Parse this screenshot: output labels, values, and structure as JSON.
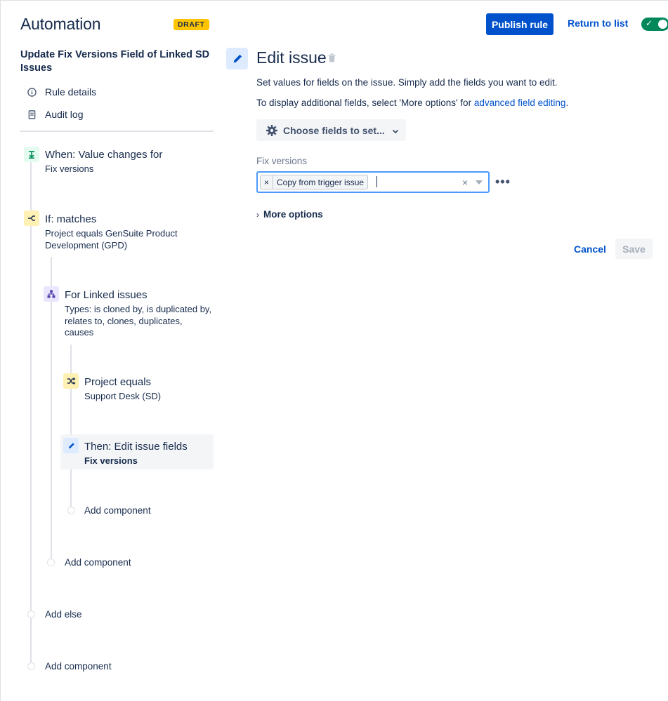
{
  "header": {
    "title": "Automation",
    "badge": "DRAFT",
    "publish_label": "Publish rule",
    "return_label": "Return to list",
    "toggle_on": true
  },
  "sidebar": {
    "rule_name": "Update Fix Versions Field of Linked SD Issues",
    "links": [
      {
        "label": "Rule details",
        "icon": "info-icon"
      },
      {
        "label": "Audit log",
        "icon": "document-icon"
      }
    ],
    "steps": {
      "trigger": {
        "title": "When: Value changes for",
        "subtitle": "Fix versions",
        "icon": "trigger-icon"
      },
      "condition": {
        "title": "If: matches",
        "subtitle": "Project equals GenSuite Product Development (GPD)",
        "icon": "if-branch-icon"
      },
      "branch": {
        "title": "For Linked issues",
        "subtitle": "Types: is cloned by, is duplicated by, relates to, clones, duplicates, causes",
        "icon": "hierarchy-icon"
      },
      "nested_condition": {
        "title": "Project equals",
        "subtitle": "Support Desk (SD)",
        "icon": "shuffle-icon"
      },
      "action": {
        "title": "Then: Edit issue fields",
        "subtitle": "Fix versions",
        "icon": "pencil-icon"
      }
    },
    "add_component_label": "Add component",
    "add_else_label": "Add else"
  },
  "main": {
    "title": "Edit issue",
    "desc1": "Set values for fields on the issue. Simply add the fields you want to edit.",
    "desc2_prefix": "To display additional fields, select 'More options' for ",
    "desc2_link": "advanced field editing",
    "desc2_suffix": ".",
    "choose_fields_label": "Choose fields to set...",
    "field_label": "Fix versions",
    "field_tag": "Copy from trigger issue",
    "tag_remove": "×",
    "clear_symbol": "×",
    "more_dots": "•••",
    "more_options_label": "More options",
    "cancel_label": "Cancel",
    "save_label": "Save"
  },
  "colors": {
    "brand": "#0052CC",
    "badge": "#FFC400",
    "toggle": "#00875A",
    "trigger_icon_bg": "#E3FCEF",
    "condition_icon_bg": "#FFF0B3",
    "branch_icon_bg": "#EAE6FF",
    "action_icon_bg": "#DEEBFF"
  }
}
